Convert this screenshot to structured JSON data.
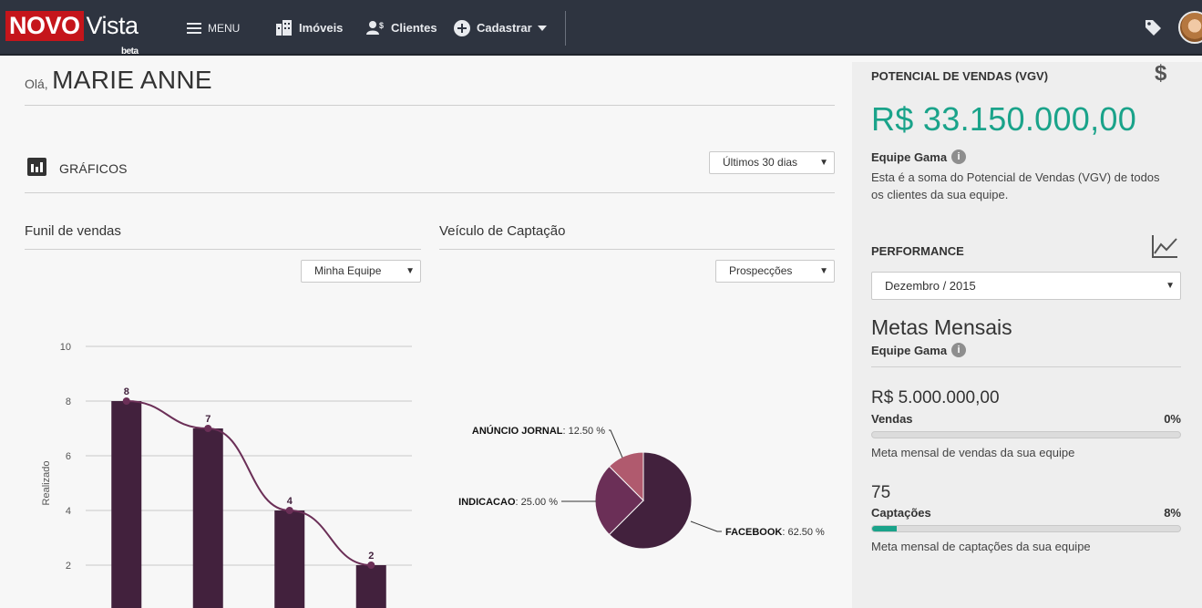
{
  "header": {
    "logo_novo": "NOVO",
    "logo_vista": "Vista",
    "logo_beta": "beta",
    "menu_label": "MENU",
    "imoveis_label": "Imóveis",
    "clientes_label": "Clientes",
    "cadastrar_label": "Cadastrar"
  },
  "greeting": {
    "prefix": "Olá,",
    "name": "MARIE ANNE"
  },
  "graficos": {
    "title": "GRÁFICOS",
    "period_select": "Últimos 30 dias"
  },
  "funil": {
    "title": "Funil de vendas",
    "select": "Minha Equipe"
  },
  "veiculo": {
    "title": "Veículo de Captação",
    "select": "Prospecções"
  },
  "chart_data": [
    {
      "type": "bar",
      "title": "Funil de vendas",
      "ylabel": "Realizado",
      "ylim": [
        0,
        10
      ],
      "yticks": [
        2,
        4,
        6,
        8,
        10
      ],
      "grid": true,
      "series": [
        {
          "values": [
            8,
            7,
            4,
            2
          ]
        }
      ],
      "data_labels": [
        "8",
        "7",
        "4",
        "2"
      ],
      "trend_line": true,
      "color": "#42213d"
    },
    {
      "type": "pie",
      "title": "Veículo de Captação",
      "slices": [
        {
          "label": "FACEBOOK",
          "value": 62.5,
          "display": ": 62.50 %",
          "color": "#42213d"
        },
        {
          "label": "INDICACAO",
          "value": 25.0,
          "display": ": 25.00 %",
          "color": "#6b2f57"
        },
        {
          "label": "ANÚNCIO JORNAL",
          "value": 12.5,
          "display": ": 12.50 %",
          "color": "#b05a6e"
        }
      ]
    }
  ],
  "panel": {
    "vgv_title": "POTENCIAL DE VENDAS (VGV)",
    "vgv_value": "R$ 33.150.000,00",
    "team": "Equipe Gama",
    "vgv_desc_1": "Esta é a soma do Potencial de Vendas (VGV) de todos",
    "vgv_desc_2": "os clientes da sua equipe.",
    "performance_title": "PERFORMANCE",
    "month_select": "Dezembro / 2015",
    "metas_title": "Metas Mensais",
    "metas_team": "Equipe Gama",
    "vendas": {
      "value": "R$ 5.000.000,00",
      "label": "Vendas",
      "pct": "0%",
      "progress": 0,
      "desc": "Meta mensal de vendas da sua equipe"
    },
    "captacoes": {
      "value": "75",
      "label": "Captações",
      "pct": "8%",
      "progress": 0.08,
      "desc": "Meta mensal de captações da sua equipe"
    },
    "accent": "#1aa38a"
  }
}
